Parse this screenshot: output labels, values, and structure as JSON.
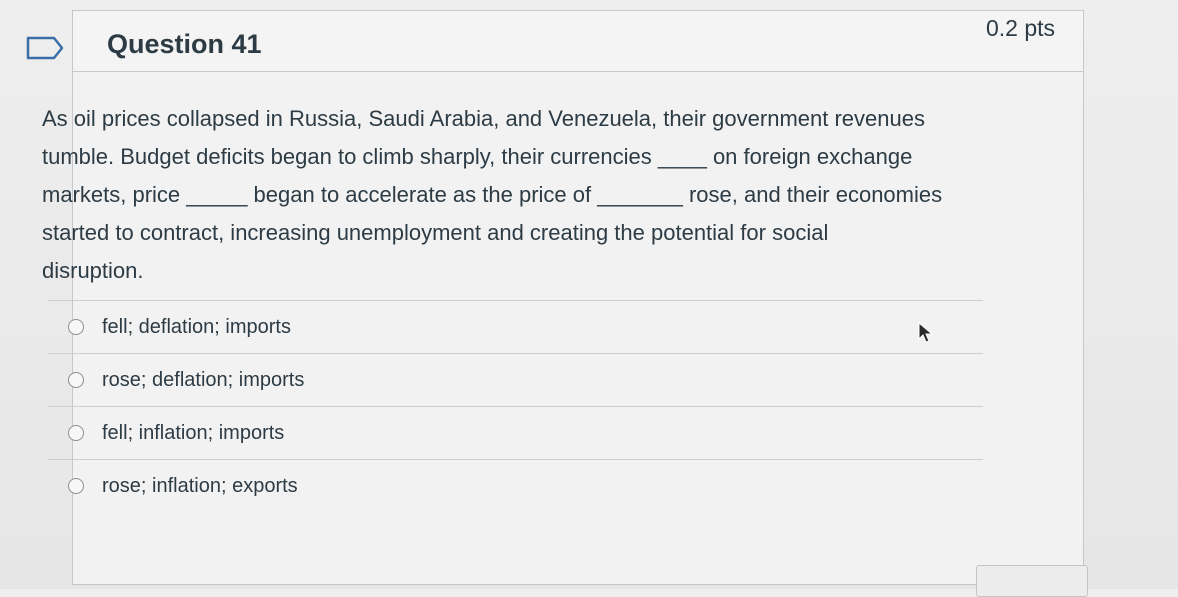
{
  "question": {
    "title": "Question 41",
    "points": "0.2 pts",
    "text_lines": [
      "As oil prices collapsed in Russia, Saudi Arabia, and Venezuela, their government revenues",
      "tumble. Budget deficits began to climb sharply, their currencies ____ on foreign exchange",
      "markets, price _____ began to accelerate as the price of _______ rose, and their economies",
      "started to contract, increasing unemployment and creating the potential for social",
      "disruption."
    ]
  },
  "answers": [
    {
      "label": "fell; deflation; imports",
      "selected": false
    },
    {
      "label": "rose; deflation; imports",
      "selected": false
    },
    {
      "label": "fell; inflation; imports",
      "selected": false
    },
    {
      "label": "rose; inflation; exports",
      "selected": false
    }
  ],
  "icons": {
    "flag": "bookmark-flag-icon",
    "cursor": "mouse-pointer-icon"
  },
  "colors": {
    "text": "#2d3b45",
    "border": "#c7c7c7",
    "flag": "#3b6ea8"
  }
}
